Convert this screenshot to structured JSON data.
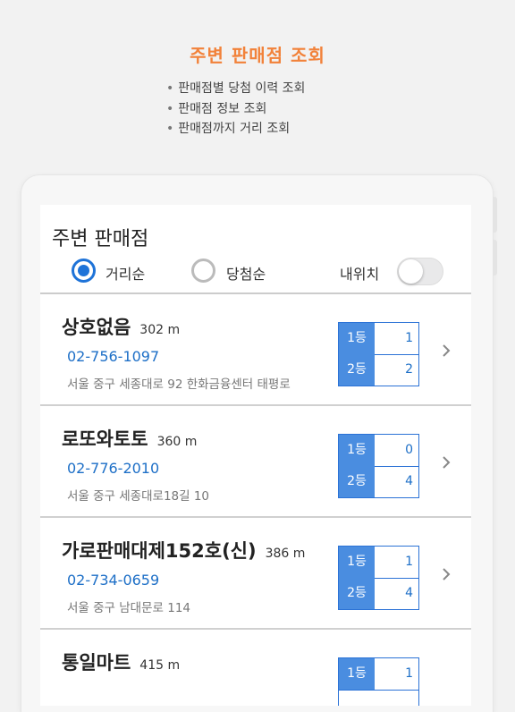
{
  "promo": {
    "title": "주변 판매점 조회",
    "bullets": [
      "판매점별 당첨 이력 조회",
      "판매점 정보 조회",
      "판매점까지 거리 조회"
    ],
    "bullet_char": "•"
  },
  "screen": {
    "title": "주변 판매점",
    "sort_options": [
      {
        "label": "거리순",
        "selected": true
      },
      {
        "label": "당첨순",
        "selected": false
      }
    ],
    "my_location_label": "내위치",
    "my_location_on": false
  },
  "stores": [
    {
      "name": "상호없음",
      "distance": "302 m",
      "phone": "02-756-1097",
      "address": "서울 중구 세종대로 92 한화금융센터 태평로",
      "rank1_label": "1등",
      "rank1_count": "1",
      "rank2_label": "2등",
      "rank2_count": "2"
    },
    {
      "name": "로또와토토",
      "distance": "360 m",
      "phone": "02-776-2010",
      "address": "서울 중구 세종대로18길 10",
      "rank1_label": "1등",
      "rank1_count": "0",
      "rank2_label": "2등",
      "rank2_count": "4"
    },
    {
      "name": "가로판매대제152호(신)",
      "distance": "386 m",
      "phone": "02-734-0659",
      "address": "서울 중구 남대문로 114",
      "rank1_label": "1등",
      "rank1_count": "1",
      "rank2_label": "2등",
      "rank2_count": "4"
    },
    {
      "name": "통일마트",
      "distance": "415 m",
      "phone": "",
      "address": "",
      "rank1_label": "1등",
      "rank1_count": "1",
      "rank2_label": "",
      "rank2_count": ""
    }
  ],
  "colors": {
    "accent": "#f2823a",
    "primary": "#1e73d8",
    "rank_bg": "#4a8de0",
    "phone": "#1d6fc7"
  },
  "icons": {
    "chevron": "chevron-right-icon"
  }
}
